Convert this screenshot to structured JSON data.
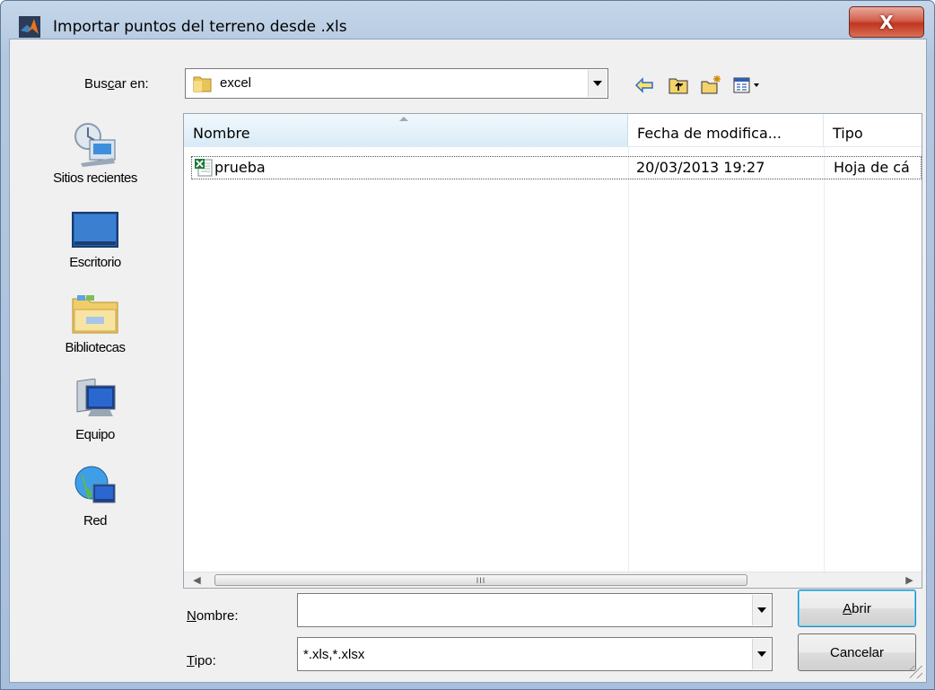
{
  "window": {
    "title": "Importar puntos del terreno desde .xls",
    "close_label": "X"
  },
  "lookin": {
    "label_pre": "Bus",
    "label_u": "c",
    "label_post": "ar en:",
    "value": "excel"
  },
  "toolbar": {
    "icons": [
      "back-icon",
      "up-folder-icon",
      "new-folder-icon",
      "view-menu-icon"
    ]
  },
  "places": [
    {
      "label": "Sitios recientes",
      "icon": "recent-places-icon"
    },
    {
      "label": "Escritorio",
      "icon": "desktop-icon"
    },
    {
      "label": "Bibliotecas",
      "icon": "libraries-icon"
    },
    {
      "label": "Equipo",
      "icon": "computer-icon"
    },
    {
      "label": "Red",
      "icon": "network-icon"
    }
  ],
  "list": {
    "columns": [
      "Nombre",
      "Fecha de modifica...",
      "Tipo"
    ],
    "rows": [
      {
        "name": "prueba",
        "date": "20/03/2013 19:27",
        "type": "Hoja de cá"
      }
    ],
    "scroll_grip": "III"
  },
  "filename": {
    "label_u": "N",
    "label_post": "ombre:",
    "value": ""
  },
  "filetype": {
    "label_u": "T",
    "label_post": "ipo:",
    "value": "*.xls,*.xlsx"
  },
  "buttons": {
    "open_u": "A",
    "open_post": "brir",
    "cancel": "Cancelar"
  },
  "colors": {
    "accent": "#3c7fb1",
    "close": "#c1361f"
  }
}
